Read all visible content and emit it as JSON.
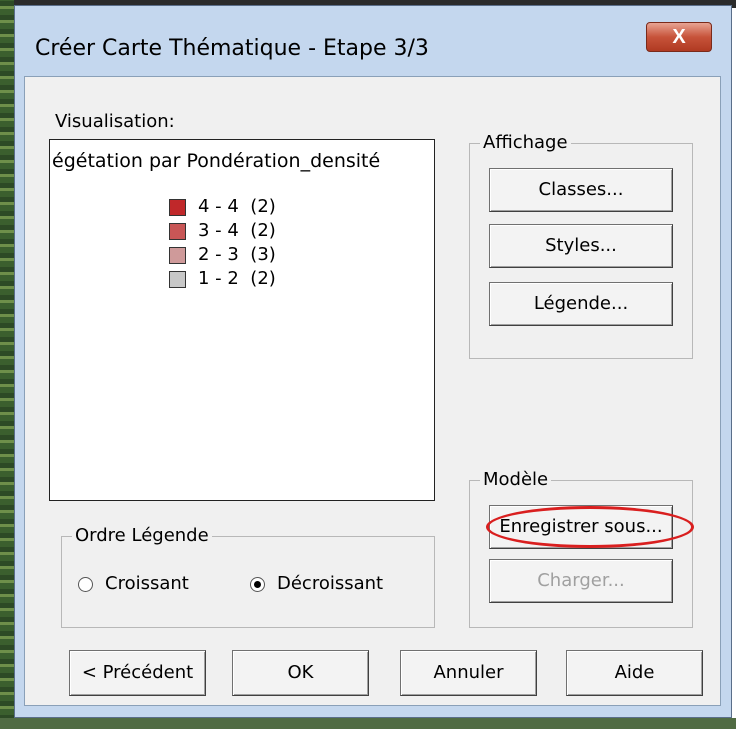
{
  "window": {
    "title": "Créer Carte Thématique - Etape 3/3",
    "close_label": "X"
  },
  "visualisation": {
    "label": "Visualisation:",
    "legend_title": "égétation par Pondération_densité",
    "items": [
      {
        "range": "4 - 4",
        "count": "(2)",
        "color": "#c0282a"
      },
      {
        "range": "3 - 4",
        "count": "(2)",
        "color": "#c85656"
      },
      {
        "range": "2 - 3",
        "count": "(3)",
        "color": "#cf9a9a"
      },
      {
        "range": "1 - 2",
        "count": "(2)",
        "color": "#c8c8c8"
      }
    ]
  },
  "affichage": {
    "label": "Affichage",
    "buttons": [
      "Classes...",
      "Styles...",
      "Légende..."
    ]
  },
  "modele": {
    "label": "Modèle",
    "save_label": "Enregistrer sous...",
    "load_label": "Charger..."
  },
  "ordre_legende": {
    "label": "Ordre Légende",
    "options": [
      {
        "label": "Croissant",
        "checked": false
      },
      {
        "label": "Décroissant",
        "checked": true
      }
    ]
  },
  "footer": {
    "previous_label": "< Précédent",
    "ok_label": "OK",
    "cancel_label": "Annuler",
    "help_label": "Aide"
  },
  "colors": {
    "highlight": "#d91f1f",
    "close_button": "#c7533a"
  }
}
